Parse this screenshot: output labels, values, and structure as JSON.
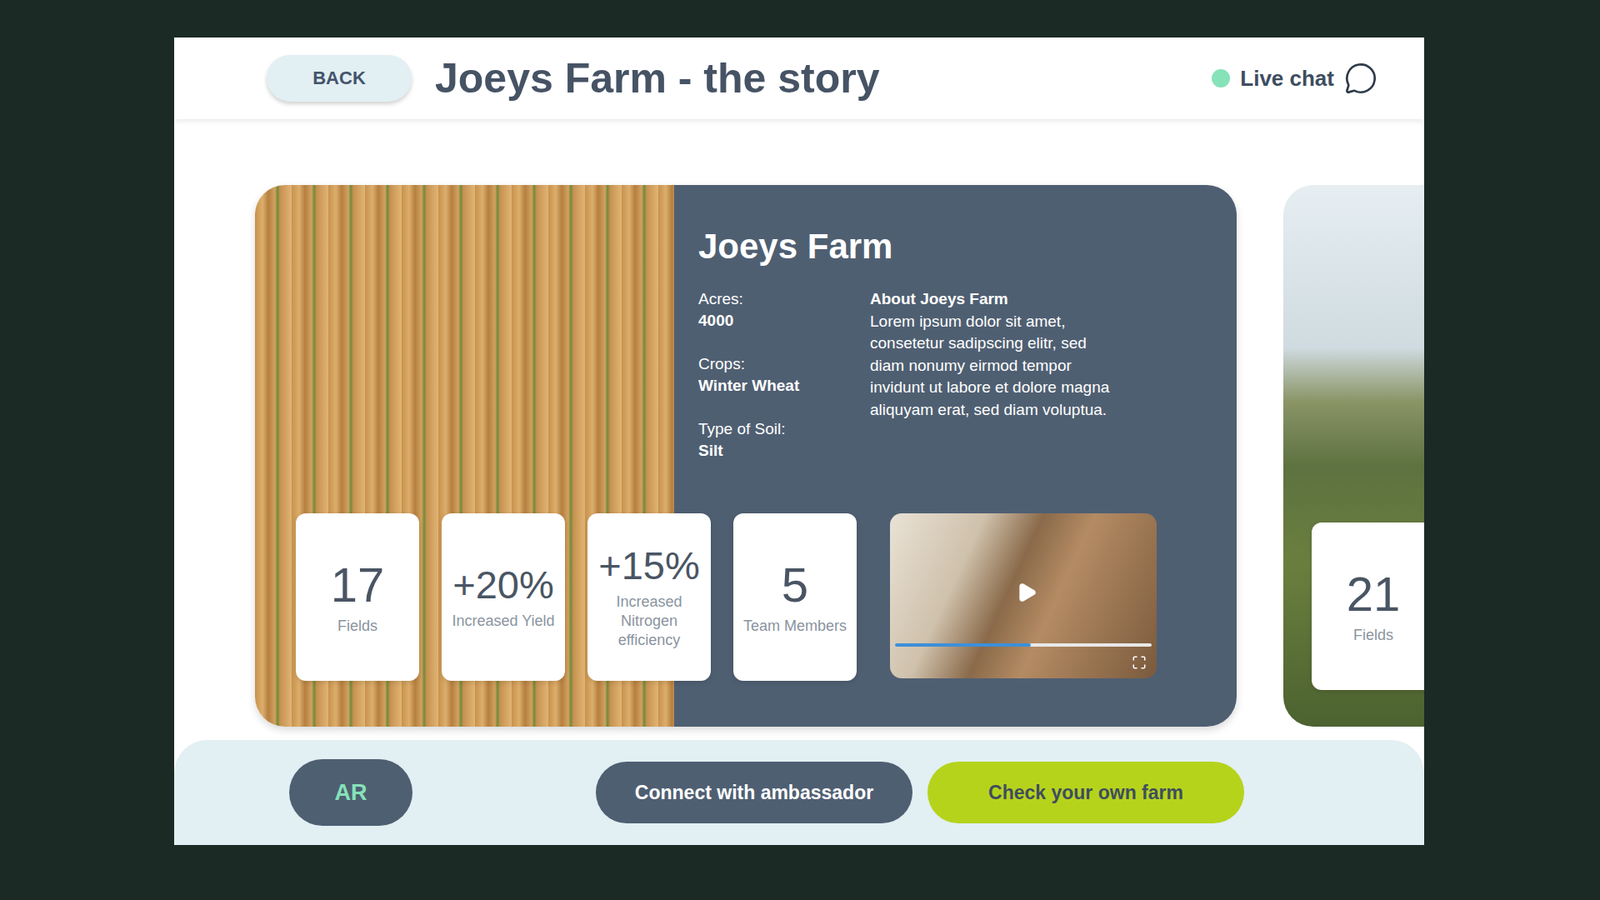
{
  "header": {
    "back": "BACK",
    "title": "Joeys Farm - the story",
    "live_chat": {
      "label": "Live chat",
      "online": true
    }
  },
  "farms": [
    {
      "name": "Joeys Farm",
      "facts": [
        {
          "label": "Acres:",
          "value": "4000"
        },
        {
          "label": "Crops:",
          "value": "Winter Wheat"
        },
        {
          "label": "Type of Soil:",
          "value": "Silt"
        }
      ],
      "about": {
        "title": "About Joeys Farm",
        "text": "Lorem ipsum dolor sit amet, consetetur sadipscing elitr, sed diam nonumy eirmod tempor invidunt ut labore et dolore magna aliquyam erat, sed diam voluptua."
      },
      "stats": [
        {
          "value": "17",
          "label": "Fields"
        },
        {
          "value": "+20%",
          "label": "Increased Yield"
        },
        {
          "value": "+15%",
          "label": "Increased Nitrogen efficiency"
        },
        {
          "value": "5",
          "label": "Team Members"
        }
      ],
      "video": {
        "level": 0.53
      }
    },
    {
      "stats": [
        {
          "value": "21",
          "label": "Fields"
        }
      ]
    }
  ],
  "actions": [
    {
      "label": "AR",
      "kind": "ar"
    },
    {
      "label": "Connect with ambassador",
      "kind": "secondary"
    },
    {
      "label": "Check your own farm",
      "kind": "primary"
    }
  ]
}
